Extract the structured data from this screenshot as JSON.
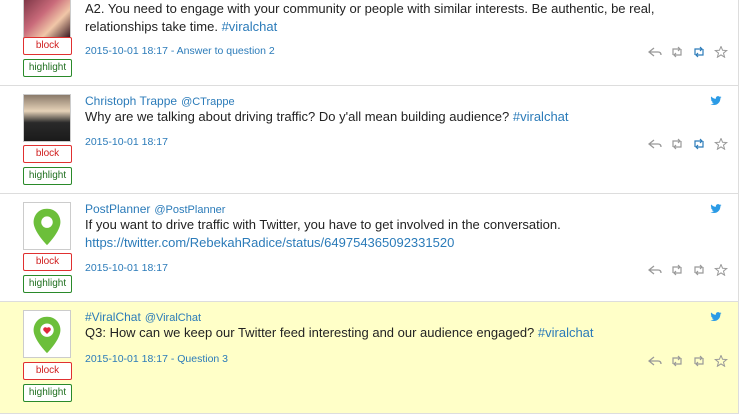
{
  "colors": {
    "link": "#2b7bb9",
    "block": "#e03030",
    "highlight": "#2a8a2a",
    "highlight_bg": "#ffffc8"
  },
  "buttons": {
    "block_label": "block",
    "highlight_label": "highlight"
  },
  "tweets": [
    {
      "name": "",
      "handle": "",
      "text": "A2. You need to engage with your community or people with similar interests. Be authentic, be real, relationships take time. ",
      "hashtag": "#viralchat",
      "meta": "2015-10-01 18:17 - Answer to question 2",
      "avatar_icon": "photo-avatar-icon"
    },
    {
      "name": "Christoph Trappe",
      "handle": "@CTrappe",
      "text": "Why are we talking about driving traffic? Do y'all mean building audience? ",
      "hashtag": "#viralchat",
      "meta": "2015-10-01 18:17",
      "avatar_icon": "photo-avatar-icon"
    },
    {
      "name": "PostPlanner",
      "handle": "@PostPlanner",
      "text": "If you want to drive traffic with Twitter, you have to get involved in the conversation.",
      "link": "https://twitter.com/RebekahRadice/status/649754365092331520",
      "meta": "2015-10-01 18:17",
      "avatar_icon": "map-pin-logo-icon"
    },
    {
      "name": "#ViralChat",
      "handle": "@ViralChat",
      "text": "Q3: How can we keep our Twitter feed interesting and our audience engaged? ",
      "hashtag": "#viralchat",
      "meta": "2015-10-01 18:17 - Question 3",
      "avatar_icon": "heart-pin-logo-icon"
    }
  ]
}
